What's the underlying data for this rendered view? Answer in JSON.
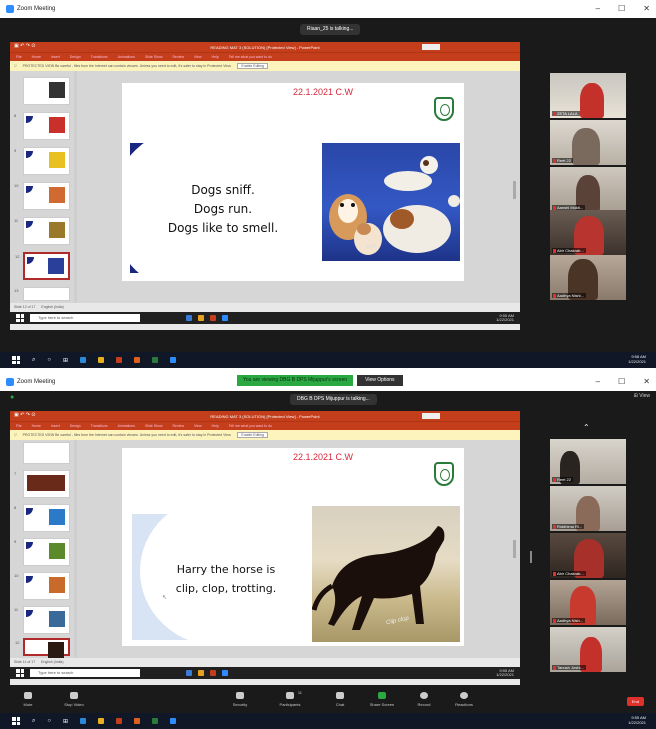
{
  "colors": {
    "zoom_blue": "#2d8cff",
    "ppt_red": "#c43e1c",
    "slide_date_red": "#d9263a",
    "zoom_green": "#2aa842",
    "end_red": "#e0302a"
  },
  "top": {
    "window_title": "Zoom Meeting",
    "talking": "Riaan_25 is talking...",
    "ppt": {
      "title_text": "READING MAT 3 (SOLUTION) [Protected View] - PowerPoint",
      "ribbon_tabs": [
        "File",
        "Home",
        "Insert",
        "Design",
        "Transitions",
        "Animations",
        "Slide Show",
        "Review",
        "View",
        "Help",
        "Tell me what you want to do"
      ],
      "protected_msg": "PROTECTED VIEW  Be careful - files from the Internet can contain viruses. Unless you need to edit, it's safer to stay in Protected View.",
      "enable_button": "Enable Editing",
      "thumb_numbers": [
        "",
        "8",
        "9",
        "10",
        "11",
        "12",
        "13"
      ],
      "status_slide": "Slide 12 of 17",
      "status_lang": "English (India)",
      "search_placeholder": "Type here to search",
      "clock_time": "9:55 AM",
      "clock_date": "1/22/2021"
    },
    "slide": {
      "date": "22.1.2021   C.W",
      "lines": [
        "Dogs sniff.",
        "Dogs run.",
        "Dogs like to smell."
      ],
      "photo_caption": "sniff"
    },
    "participants": [
      "ZETA LALA",
      "Reet 22",
      "Kavya",
      "Aanshi Mukti...",
      "Abir Chakrab...",
      "Aadhya Nishi..."
    ],
    "taskbar": {
      "time": "9:58 AM",
      "date": "1/22/2021"
    }
  },
  "bottom": {
    "window_title": "Zoom Meeting",
    "viewing_text": "You are viewing DBG B DPS Mijuppur's screen",
    "view_options": "View Options",
    "talking": "DBG B DPS Mijuppur is talking...",
    "grid_label": "View",
    "ppt": {
      "title_text": "READING MAT 3 (SOLUTION) [Protected View] - PowerPoint",
      "ribbon_tabs": [
        "File",
        "Home",
        "Insert",
        "Design",
        "Transitions",
        "Animations",
        "Slide Show",
        "Review",
        "View",
        "Help",
        "Tell me what you want to do"
      ],
      "protected_msg": "PROTECTED VIEW  Be careful - files from the Internet can contain viruses. Unless you need to edit, it's safer to stay in Protected View.",
      "enable_button": "Enable Editing",
      "thumb_numbers": [
        "",
        "7",
        "8",
        "9",
        "10",
        "11",
        "12"
      ],
      "status_slide": "Slide 11 of 17",
      "status_lang": "English (India)",
      "search_placeholder": "Type here to search",
      "clock_time": "9:55 AM",
      "clock_date": "1/22/2021"
    },
    "slide": {
      "date": "22.1.2021   C.W",
      "lines": [
        "Harry the horse is",
        "clip, clop, trotting."
      ],
      "photo_caption": "Clip clop"
    },
    "participants": [
      "Reet 22",
      "Riddhima Ri...",
      "Abir Chakrab...",
      "Aadhya Nish...",
      "Tanush Joshi..."
    ],
    "toolbar": [
      "Mute",
      "Stop Video",
      "Security",
      "Participants",
      "Chat",
      "Share Screen",
      "Record",
      "Reactions"
    ],
    "participant_count": "11",
    "end_label": "End",
    "taskbar": {
      "time": "9:55 AM",
      "date": "1/22/2021"
    }
  }
}
